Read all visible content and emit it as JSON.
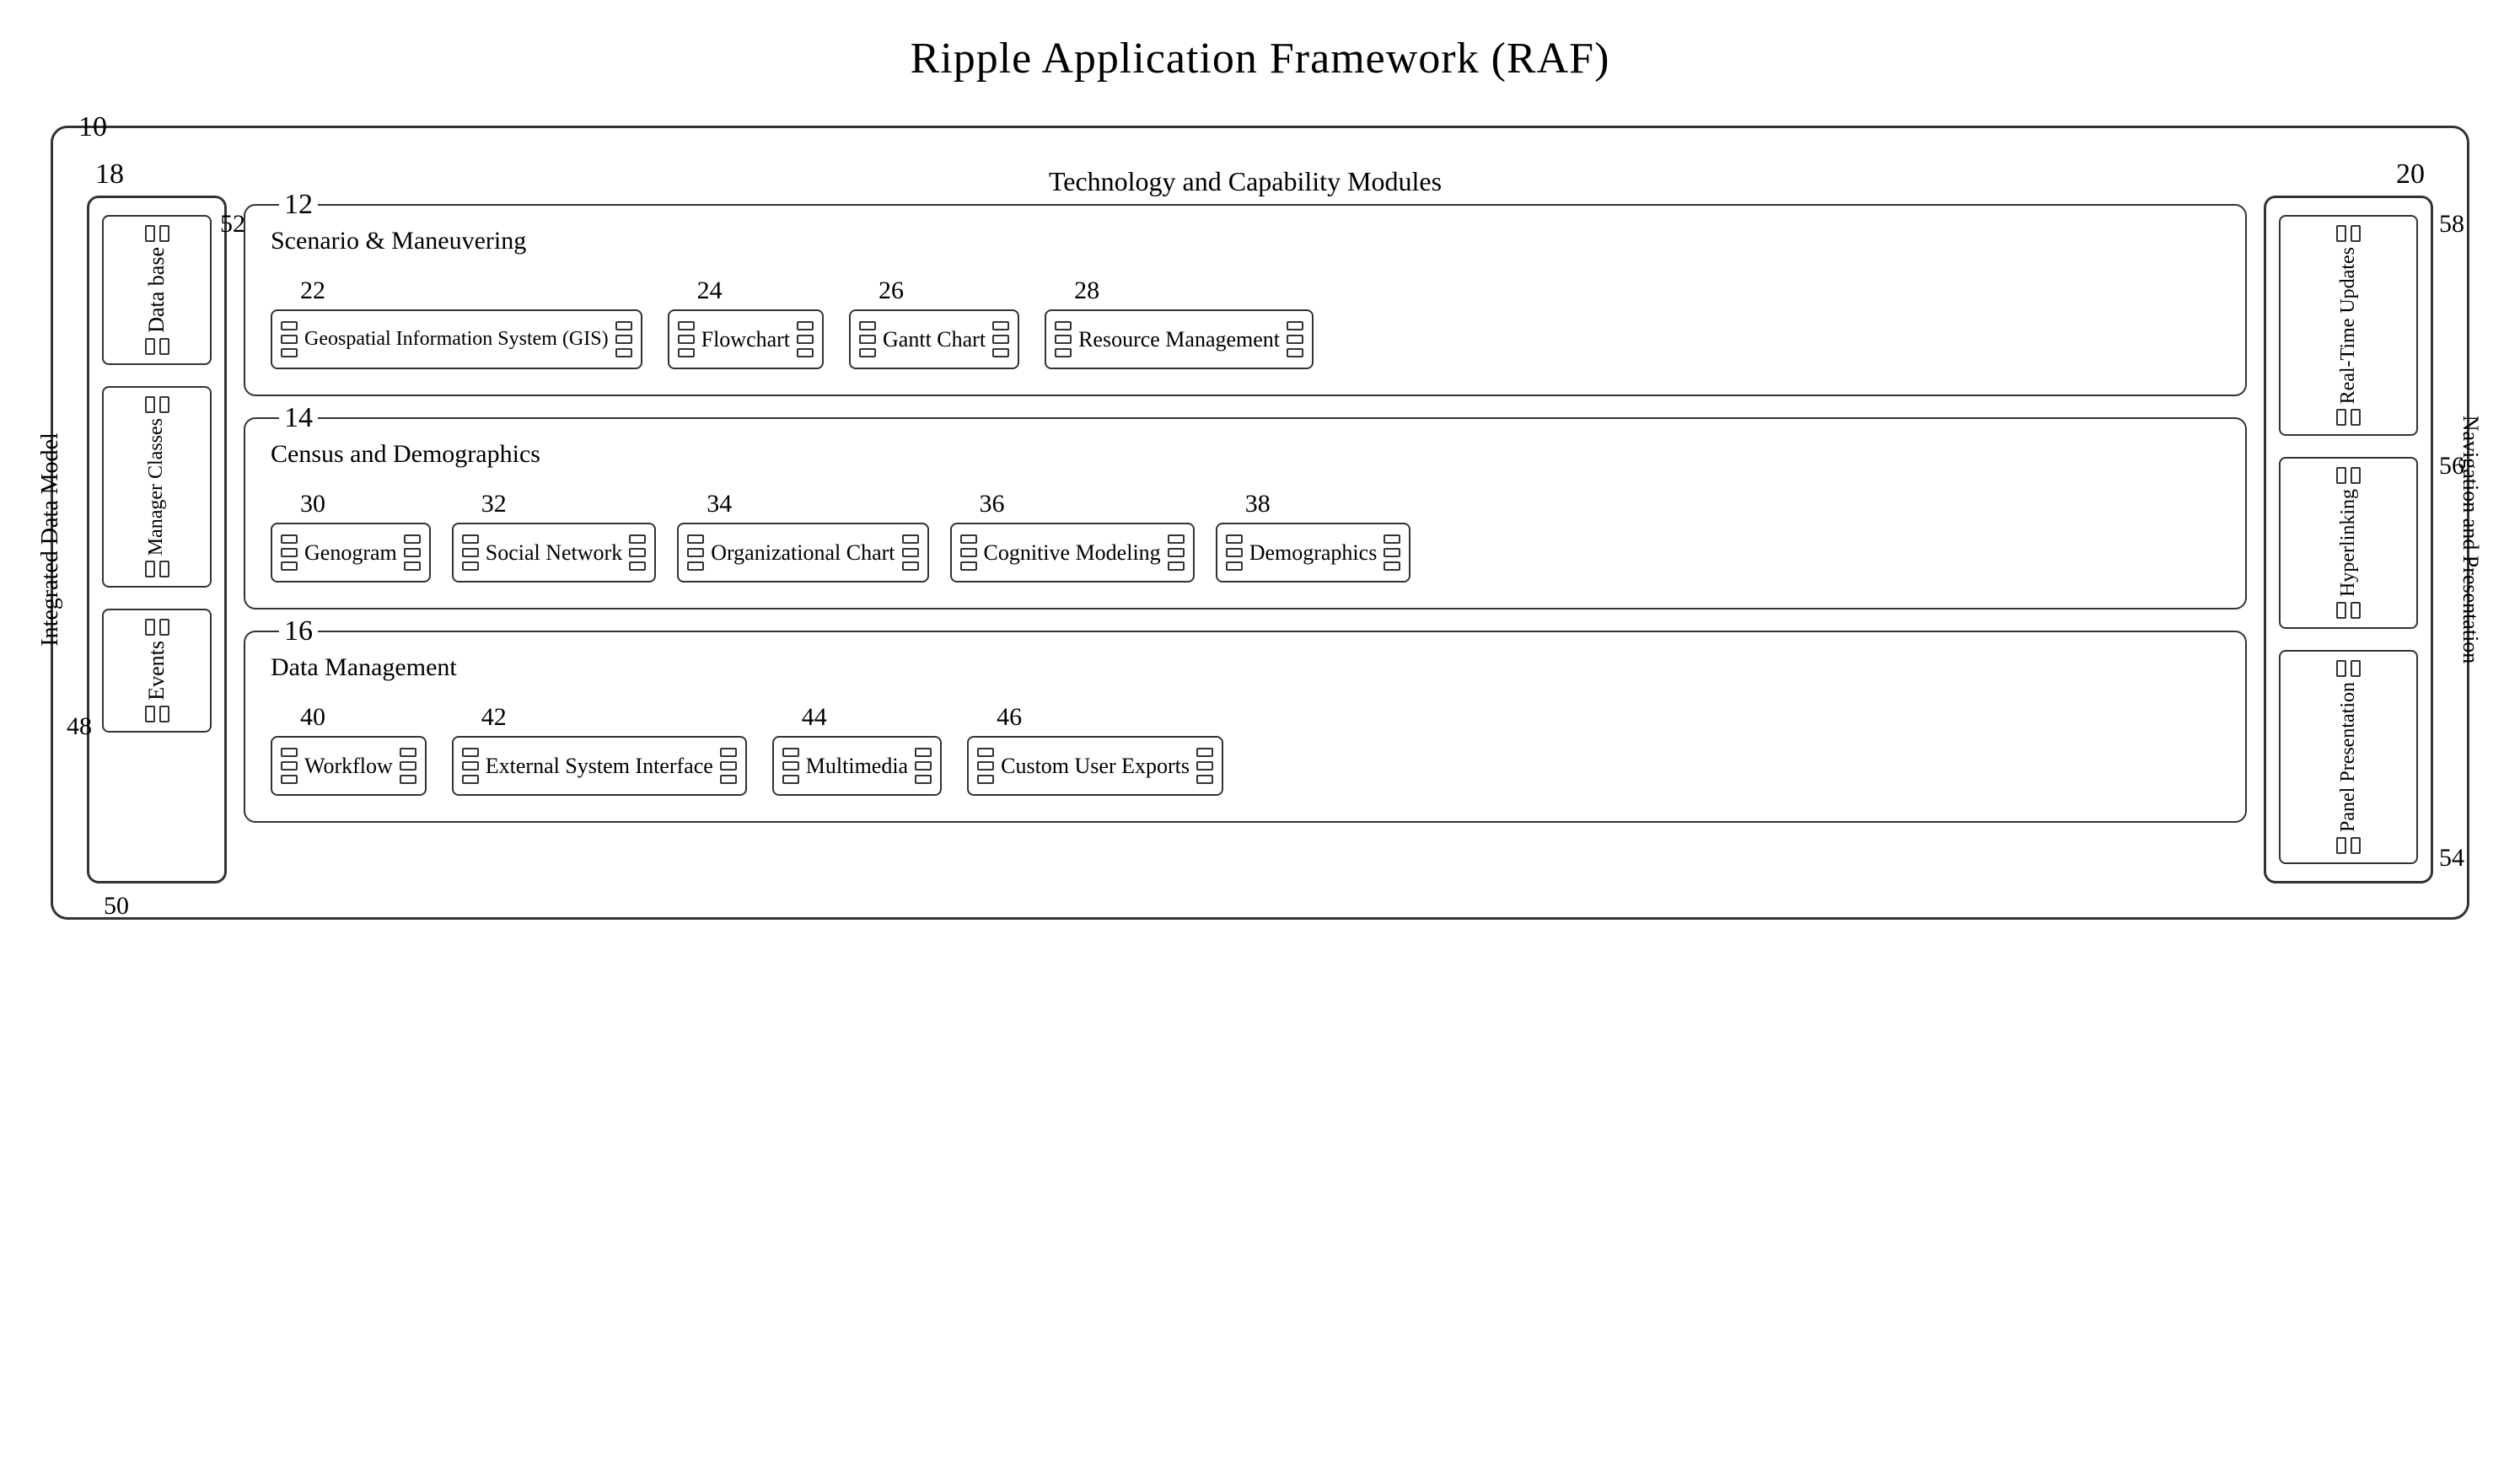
{
  "title": "Ripple Application Framework (RAF)",
  "diagram": {
    "outer_num": "10",
    "left_col": {
      "label_num": "18",
      "idm_label": "Integrated Data Model",
      "label_50": "50",
      "components": [
        {
          "id": "52",
          "label": "Data base",
          "type": "vertical"
        },
        {
          "id": "manager",
          "label": "Manager Classes",
          "type": "vertical"
        },
        {
          "id": "48",
          "label": "Events",
          "type": "vertical",
          "num_label": "48"
        }
      ]
    },
    "center_col": {
      "tech_cap_label": "Technology and Capability Modules",
      "sections": [
        {
          "id": "12",
          "title": "Scenario & Maneuvering",
          "modules": [
            {
              "num": "22",
              "label": "Geospatial Information System (GIS)"
            },
            {
              "num": "24",
              "label": "Flowchart"
            },
            {
              "num": "26",
              "label": "Gantt Chart"
            },
            {
              "num": "28",
              "label": "Resource Management"
            }
          ]
        },
        {
          "id": "14",
          "title": "Census and Demographics",
          "modules": [
            {
              "num": "30",
              "label": "Genogram"
            },
            {
              "num": "32",
              "label": "Social Network"
            },
            {
              "num": "34",
              "label": "Organizational Chart"
            },
            {
              "num": "36",
              "label": "Cognitive Modeling"
            },
            {
              "num": "38",
              "label": "Demographics"
            }
          ]
        },
        {
          "id": "16",
          "title": "Data Management",
          "modules": [
            {
              "num": "40",
              "label": "Workflow"
            },
            {
              "num": "42",
              "label": "External System Interface"
            },
            {
              "num": "44",
              "label": "Multimedia"
            },
            {
              "num": "46",
              "label": "Custom User Exports"
            }
          ]
        }
      ]
    },
    "right_col": {
      "label_num": "20",
      "nav_pres_label": "Navigation and Presentation",
      "sections": [
        {
          "id": "58",
          "label": "Real-Time Updates"
        },
        {
          "id": "56",
          "label": "Hyperlinking"
        },
        {
          "id": "54",
          "label": "Panel Presentation"
        }
      ]
    }
  }
}
